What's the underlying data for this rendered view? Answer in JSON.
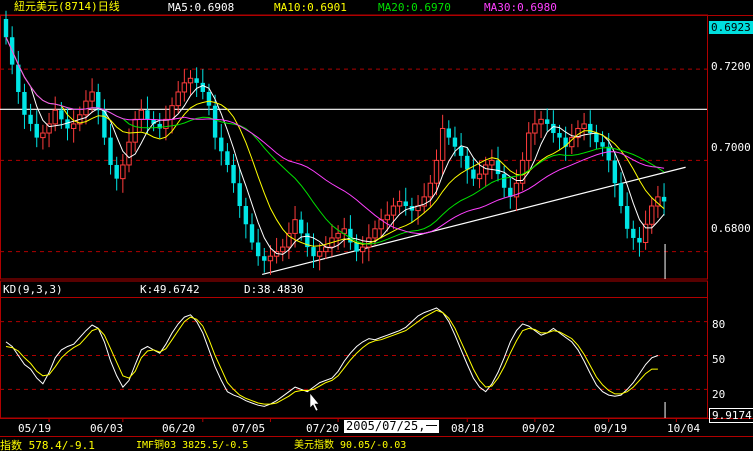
{
  "header": {
    "title": "紐元美元(8714)日线",
    "ma5": "MA5:0.6908",
    "ma10": "MA10:0.6901",
    "ma20": "MA20:0.6970",
    "ma30": "MA30:0.6980"
  },
  "kd_header": {
    "name": "KD(9,3,3)",
    "k": "K:49.6742",
    "d": "D:38.4830"
  },
  "price_axis": {
    "current": "0.6923",
    "ticks": [
      "0.7200",
      "0.7000",
      "0.6800"
    ]
  },
  "kd_axis": {
    "ticks": [
      "80",
      "50",
      "20"
    ],
    "current": "9.9174"
  },
  "date_axis": [
    "05/19",
    "06/03",
    "06/20",
    "07/05",
    "07/20",
    "08/18",
    "09/02",
    "09/19",
    "10/04"
  ],
  "cursor_date": "2005/07/25,一",
  "status_bar": {
    "item1": "指数 578.4/-9.1",
    "item2": "IMF铜03 3825.5/-0.5",
    "item3": "美元指数 90.05/-0.03"
  },
  "colors": {
    "up": "#ff3c3c",
    "down": "#00e5e5",
    "ma5": "#ffffff",
    "ma10": "#ffff00",
    "ma20": "#00e000",
    "ma30": "#ff40ff",
    "k": "#ffffff",
    "d": "#ffff00",
    "grid": "#b00000",
    "header_title": "#ffff00",
    "axis_text": "#ffffff"
  },
  "chart_data": [
    {
      "type": "candlestick",
      "ylim": [
        0.674,
        0.731
      ],
      "reference_lines": [
        0.7112
      ],
      "trendline": {
        "from": [
          1,
          0.675
        ],
        "to": [
          104,
          0.6985
        ]
      },
      "series_names": [
        "MA5",
        "MA10",
        "MA20",
        "MA30"
      ],
      "closes": [
        0.727,
        0.721,
        0.715,
        0.71,
        0.708,
        0.705,
        0.706,
        0.708,
        0.711,
        0.709,
        0.707,
        0.708,
        0.71,
        0.713,
        0.715,
        0.711,
        0.705,
        0.699,
        0.696,
        0.699,
        0.704,
        0.709,
        0.711,
        0.709,
        0.708,
        0.707,
        0.709,
        0.712,
        0.715,
        0.717,
        0.718,
        0.717,
        0.715,
        0.712,
        0.705,
        0.702,
        0.699,
        0.695,
        0.69,
        0.686,
        0.682,
        0.679,
        0.678,
        0.679,
        0.68,
        0.681,
        0.684,
        0.687,
        0.684,
        0.681,
        0.679,
        0.68,
        0.681,
        0.683,
        0.684,
        0.685,
        0.682,
        0.68,
        0.681,
        0.683,
        0.685,
        0.687,
        0.688,
        0.69,
        0.691,
        0.69,
        0.689,
        0.69,
        0.692,
        0.695,
        0.7,
        0.707,
        0.705,
        0.703,
        0.701,
        0.698,
        0.696,
        0.697,
        0.699,
        0.7,
        0.697,
        0.694,
        0.692,
        0.695,
        0.7,
        0.706,
        0.708,
        0.709,
        0.708,
        0.706,
        0.705,
        0.703,
        0.705,
        0.707,
        0.708,
        0.706,
        0.704,
        0.703,
        0.7,
        0.695,
        0.69,
        0.685,
        0.683,
        0.682,
        0.686,
        0.69,
        0.692,
        0.691
      ],
      "x_ticks": [
        {
          "index": 7,
          "label": "05/19"
        },
        {
          "index": 19,
          "label": "06/03"
        },
        {
          "index": 32,
          "label": "06/20"
        },
        {
          "index": 43,
          "label": "07/05"
        },
        {
          "index": 54,
          "label": "07/20"
        },
        {
          "index": 75,
          "label": "08/18"
        },
        {
          "index": 86,
          "label": "09/02"
        },
        {
          "index": 98,
          "label": "09/19"
        },
        {
          "index": 109,
          "label": "10/04"
        }
      ]
    },
    {
      "type": "line",
      "ylim": [
        0,
        100
      ],
      "reference_lines": [
        80,
        50,
        20
      ],
      "series": [
        {
          "name": "K",
          "values": [
            62,
            58,
            50,
            42,
            38,
            30,
            25,
            35,
            48,
            55,
            58,
            60,
            66,
            72,
            77,
            74,
            62,
            45,
            32,
            22,
            28,
            42,
            55,
            58,
            55,
            52,
            60,
            70,
            78,
            84,
            86,
            80,
            70,
            55,
            40,
            28,
            18,
            15,
            13,
            10,
            8,
            6,
            5,
            7,
            10,
            14,
            18,
            22,
            20,
            18,
            22,
            26,
            28,
            30,
            36,
            45,
            52,
            58,
            62,
            65,
            64,
            66,
            68,
            70,
            72,
            75,
            80,
            85,
            88,
            90,
            92,
            88,
            80,
            68,
            55,
            42,
            30,
            22,
            18,
            25,
            35,
            48,
            62,
            72,
            78,
            76,
            72,
            68,
            70,
            74,
            70,
            66,
            62,
            55,
            45,
            34,
            24,
            18,
            15,
            14,
            15,
            20,
            26,
            34,
            42,
            48,
            50
          ]
        },
        {
          "name": "D",
          "values": [
            58,
            57,
            54,
            48,
            43,
            36,
            32,
            33,
            40,
            48,
            53,
            57,
            60,
            66,
            72,
            74,
            68,
            56,
            44,
            32,
            30,
            36,
            48,
            54,
            55,
            53,
            56,
            64,
            72,
            80,
            84,
            82,
            76,
            64,
            50,
            38,
            26,
            20,
            15,
            12,
            10,
            8,
            7,
            7,
            8,
            11,
            14,
            18,
            19,
            19,
            20,
            23,
            26,
            28,
            32,
            39,
            46,
            52,
            57,
            61,
            63,
            64,
            66,
            68,
            70,
            72,
            76,
            80,
            84,
            87,
            90,
            88,
            83,
            74,
            62,
            50,
            38,
            28,
            22,
            23,
            30,
            40,
            52,
            63,
            72,
            74,
            73,
            70,
            70,
            72,
            71,
            68,
            65,
            59,
            51,
            41,
            31,
            24,
            19,
            16,
            16,
            18,
            22,
            28,
            34,
            38,
            38
          ]
        }
      ]
    }
  ]
}
